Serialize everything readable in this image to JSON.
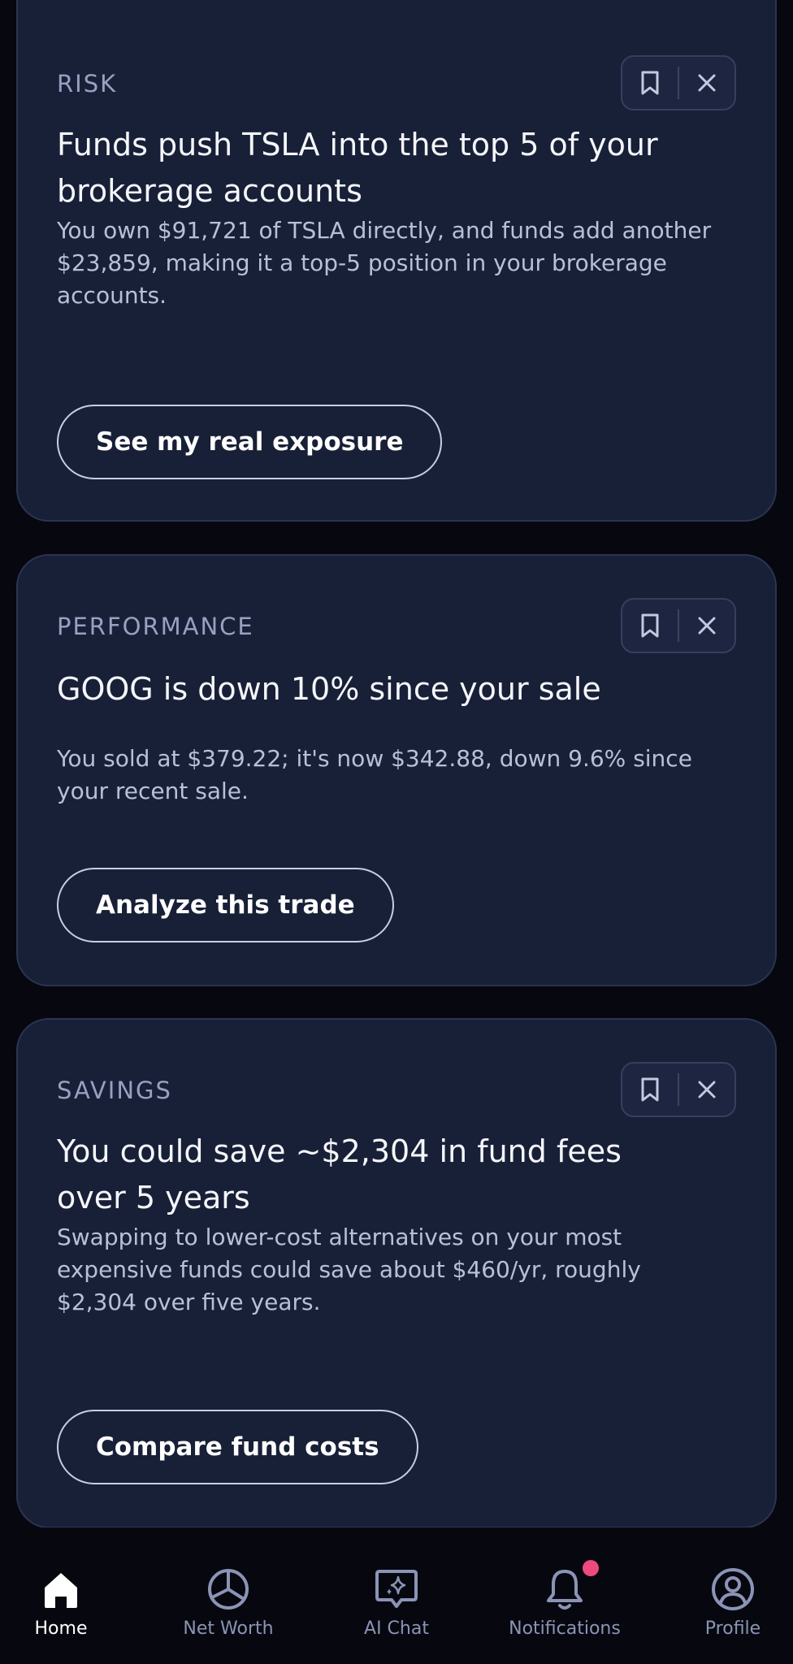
{
  "cards": [
    {
      "category": "RISK",
      "title": "Funds push TSLA into the top 5 of your brokerage accounts",
      "body": "You own $91,721 of TSLA directly, and funds add another $23,859, making it a top-5 position in your brokerage accounts.",
      "cta_label": "See my real exposure"
    },
    {
      "category": "PERFORMANCE",
      "title": "GOOG is down 10% since your sale",
      "body": "You sold at $379.22; it's now $342.88, down 9.6% since your recent sale.",
      "cta_label": "Analyze this trade"
    },
    {
      "category": "SAVINGS",
      "title": "You could save ~$2,304 in fund fees over 5 years",
      "body": "Swapping to lower-cost alternatives on your most expensive funds could save about $460/yr, roughly $2,304 over five years.",
      "cta_label": "Compare fund costs"
    }
  ],
  "nav": {
    "items": [
      {
        "label": "Home",
        "icon": "home-icon",
        "active": true
      },
      {
        "label": "Net Worth",
        "icon": "pie-chart-icon"
      },
      {
        "label": "AI Chat",
        "icon": "sparkle-chat-icon"
      },
      {
        "label": "Notifications",
        "icon": "bell-icon",
        "has_badge": true
      },
      {
        "label": "Profile",
        "icon": "profile-icon"
      }
    ]
  },
  "colors": {
    "background": "#07080f",
    "card": "#182037",
    "card_border": "#2b3452",
    "badge": "#ee4a7f",
    "nav_inactive": "#8b94b6"
  }
}
